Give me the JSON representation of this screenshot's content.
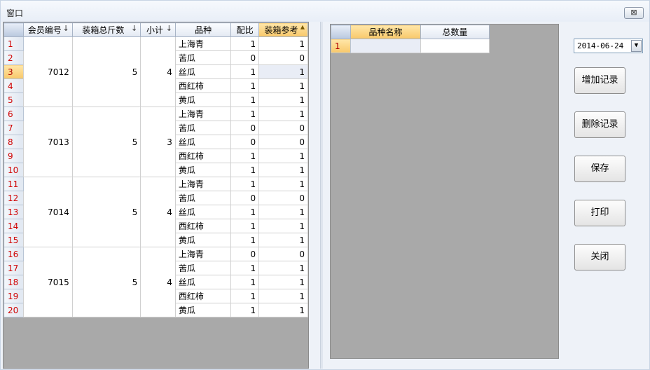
{
  "window": {
    "title": "窗口",
    "close_label": "⊠"
  },
  "left_grid": {
    "columns": [
      "会员编号",
      "装箱总斤数",
      "小计",
      "品种",
      "配比",
      "装箱参考"
    ],
    "sort_arrow": "↓",
    "sort_asc_marker": "▲",
    "groups": [
      {
        "member_id": "7012",
        "total_jin": "5",
        "subtotal": "4",
        "rows": [
          {
            "n": "1",
            "variety": "上海青",
            "ratio": "1",
            "ref": "1"
          },
          {
            "n": "2",
            "variety": "苦瓜",
            "ratio": "0",
            "ref": "0"
          },
          {
            "n": "3",
            "variety": "丝瓜",
            "ratio": "1",
            "ref": "1"
          },
          {
            "n": "4",
            "variety": "西红柿",
            "ratio": "1",
            "ref": "1"
          },
          {
            "n": "5",
            "variety": "黄瓜",
            "ratio": "1",
            "ref": "1"
          }
        ]
      },
      {
        "member_id": "7013",
        "total_jin": "5",
        "subtotal": "3",
        "rows": [
          {
            "n": "6",
            "variety": "上海青",
            "ratio": "1",
            "ref": "1"
          },
          {
            "n": "7",
            "variety": "苦瓜",
            "ratio": "0",
            "ref": "0"
          },
          {
            "n": "8",
            "variety": "丝瓜",
            "ratio": "0",
            "ref": "0"
          },
          {
            "n": "9",
            "variety": "西红柿",
            "ratio": "1",
            "ref": "1"
          },
          {
            "n": "10",
            "variety": "黄瓜",
            "ratio": "1",
            "ref": "1"
          }
        ]
      },
      {
        "member_id": "7014",
        "total_jin": "5",
        "subtotal": "4",
        "rows": [
          {
            "n": "11",
            "variety": "上海青",
            "ratio": "1",
            "ref": "1"
          },
          {
            "n": "12",
            "variety": "苦瓜",
            "ratio": "0",
            "ref": "0"
          },
          {
            "n": "13",
            "variety": "丝瓜",
            "ratio": "1",
            "ref": "1"
          },
          {
            "n": "14",
            "variety": "西红柿",
            "ratio": "1",
            "ref": "1"
          },
          {
            "n": "15",
            "variety": "黄瓜",
            "ratio": "1",
            "ref": "1"
          }
        ]
      },
      {
        "member_id": "7015",
        "total_jin": "5",
        "subtotal": "4",
        "rows": [
          {
            "n": "16",
            "variety": "上海青",
            "ratio": "0",
            "ref": "0"
          },
          {
            "n": "17",
            "variety": "苦瓜",
            "ratio": "1",
            "ref": "1"
          },
          {
            "n": "18",
            "variety": "丝瓜",
            "ratio": "1",
            "ref": "1"
          },
          {
            "n": "19",
            "variety": "西红柿",
            "ratio": "1",
            "ref": "1"
          },
          {
            "n": "20",
            "variety": "黄瓜",
            "ratio": "1",
            "ref": "1"
          }
        ]
      }
    ],
    "current_row": "3"
  },
  "right_grid": {
    "columns": [
      "品种名称",
      "总数量"
    ],
    "rows": [
      {
        "n": "1",
        "name": "",
        "qty": ""
      }
    ]
  },
  "controls": {
    "date_value": "2014-06-24",
    "dropdown_glyph": "▼",
    "add_label": "增加记录",
    "delete_label": "删除记录",
    "save_label": "保存",
    "print_label": "打印",
    "close_label": "关闭"
  },
  "colors": {
    "row_number": "#d00000",
    "sorted_header": "#f8c86a",
    "empty_area": "#a9a9a9"
  }
}
